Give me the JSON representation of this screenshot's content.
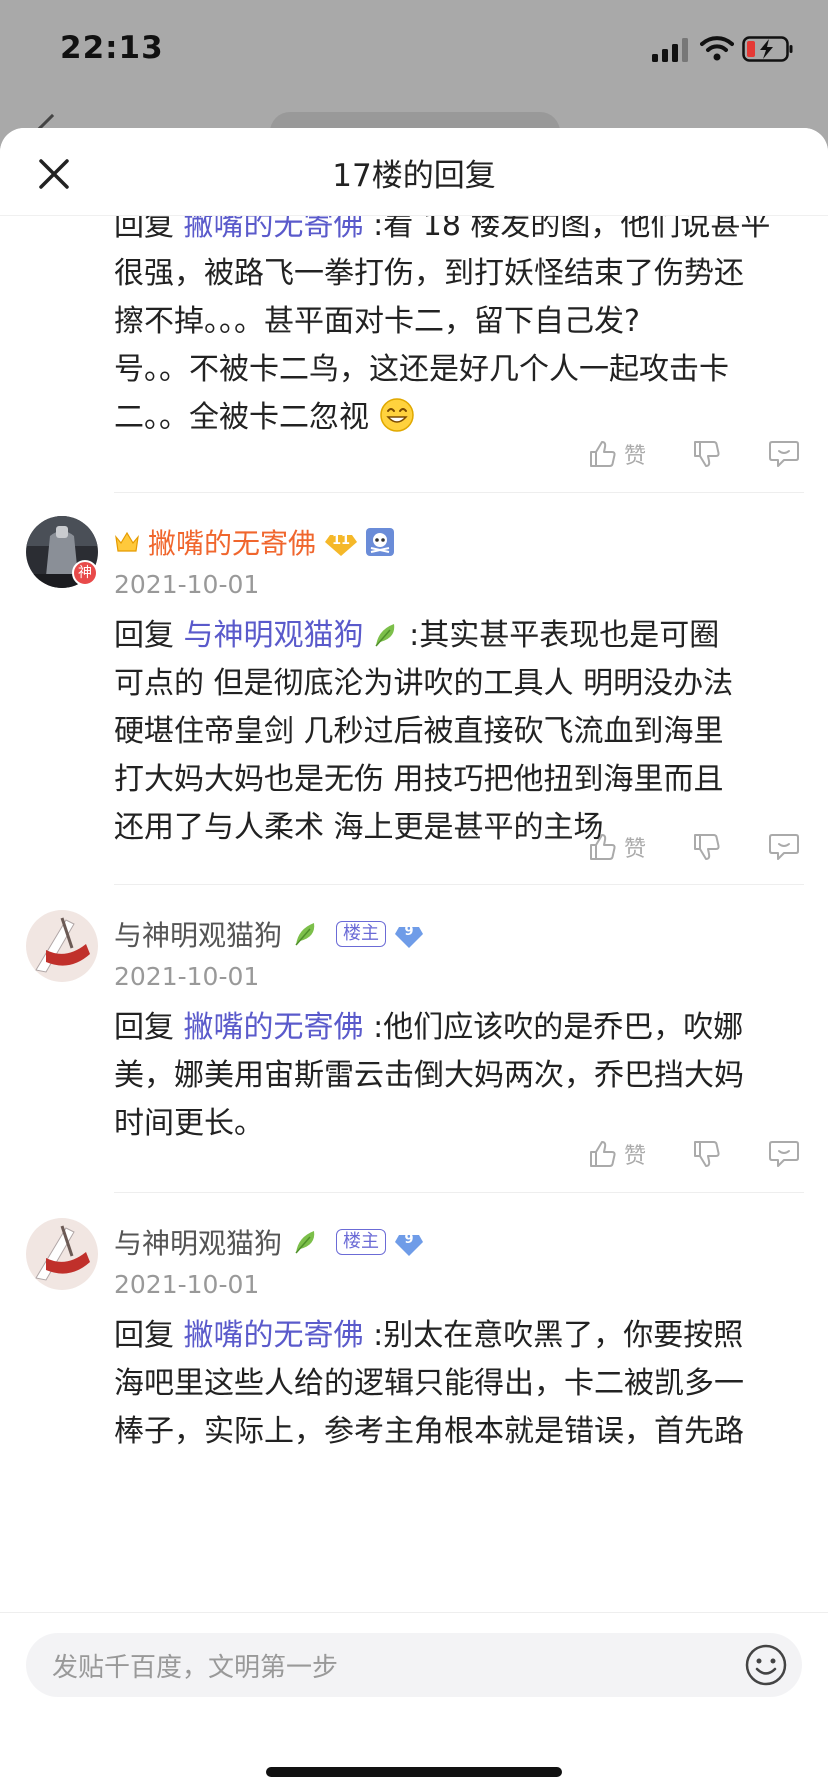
{
  "status": {
    "time": "22:13"
  },
  "header": {
    "title": "17楼的回复"
  },
  "action_labels": {
    "like": "赞"
  },
  "replies": [
    {
      "reply_prefix": "回复",
      "mention": "撇嘴的无寄佛",
      "lines": [
        " :看 18 楼发的图，他们说甚平",
        "很强，被路飞一拳打伤，到打妖怪结束了伤势还",
        "擦不掉。。。甚平面对卡二，留下自己发?",
        "号。。不被卡二鸟，这还是好几个人一起攻击卡",
        "二。。全被卡二忽视"
      ]
    },
    {
      "username": "撇嘴的无寄佛",
      "level": "11",
      "avatar_tag": "神",
      "date": "2021-10-01",
      "reply_prefix": "回复",
      "mention": "与神明观猫狗",
      "lines": [
        " :其实甚平表现也是可圈",
        "可点的 但是彻底沦为讲吹的工具人 明明没办法",
        "硬堪住帝皇剑 几秒过后被直接砍飞流血到海里",
        "打大妈大妈也是无伤 用技巧把他扭到海里而且",
        "还用了与人柔术 海上更是甚平的主场"
      ]
    },
    {
      "username": "与神明观猫狗",
      "badge": "楼主",
      "level": "9",
      "date": "2021-10-01",
      "reply_prefix": "回复",
      "mention": "撇嘴的无寄佛",
      "lines": [
        " :他们应该吹的是乔巴，吹娜",
        "美，娜美用宙斯雷云击倒大妈两次，乔巴挡大妈",
        "时间更长。"
      ]
    },
    {
      "username": "与神明观猫狗",
      "badge": "楼主",
      "level": "9",
      "date": "2021-10-01",
      "reply_prefix": "回复",
      "mention": "撇嘴的无寄佛",
      "lines": [
        " :别太在意吹黑了，你要按照",
        "海吧里这些人给的逻辑只能得出，卡二被凯多一",
        "棒子，实际上，参考主角根本就是错误，首先路"
      ]
    }
  ],
  "composer": {
    "placeholder": "发贴千百度，文明第一步"
  }
}
